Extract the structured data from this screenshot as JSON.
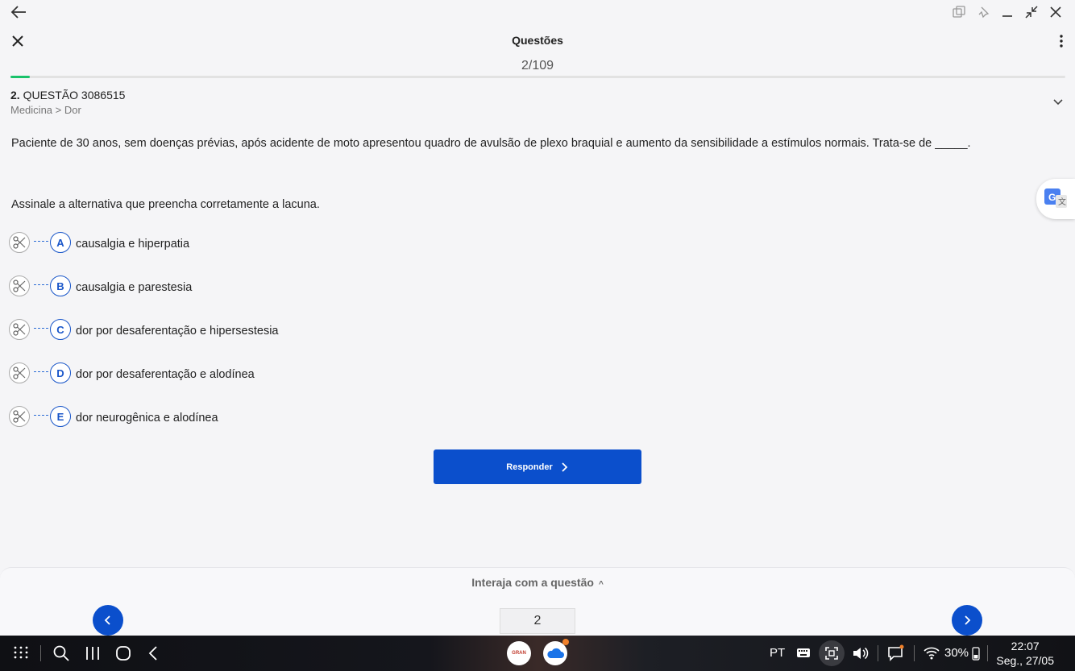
{
  "app": {
    "title": "Questões",
    "counter": "2/109",
    "progress_fraction": 0.018
  },
  "question": {
    "number_prefix": "2.",
    "number_label": "QUESTÃO 3086515",
    "breadcrumb": "Medicina > Dor",
    "statement": "Paciente de 30 anos, sem doenças prévias, após acidente de moto apresentou quadro de avulsão de plexo braquial e aumento da sensibilidade a estímulos normais. Trata-se de _____.",
    "instruction": "Assinale a alternativa que preencha corretamente a lacuna.",
    "options": [
      {
        "letter": "A",
        "text": "causalgia e hiperpatia"
      },
      {
        "letter": "B",
        "text": "causalgia e parestesia"
      },
      {
        "letter": "C",
        "text": "dor por desaferentação e hipersestesia"
      },
      {
        "letter": "D",
        "text": "dor por desaferentação e alodínea"
      },
      {
        "letter": "E",
        "text": "dor neurogênica e alodínea"
      }
    ]
  },
  "actions": {
    "respond_label": "Responder"
  },
  "footer": {
    "interact_label": "Interaja com a questão",
    "page_value": "2"
  },
  "taskbar": {
    "language": "PT",
    "battery": "30%",
    "time": "22:07",
    "date": "Seg., 27/05",
    "gran_app_label": "GRAN"
  },
  "colors": {
    "accent": "#0b4fcc",
    "progress": "#19c26a"
  }
}
